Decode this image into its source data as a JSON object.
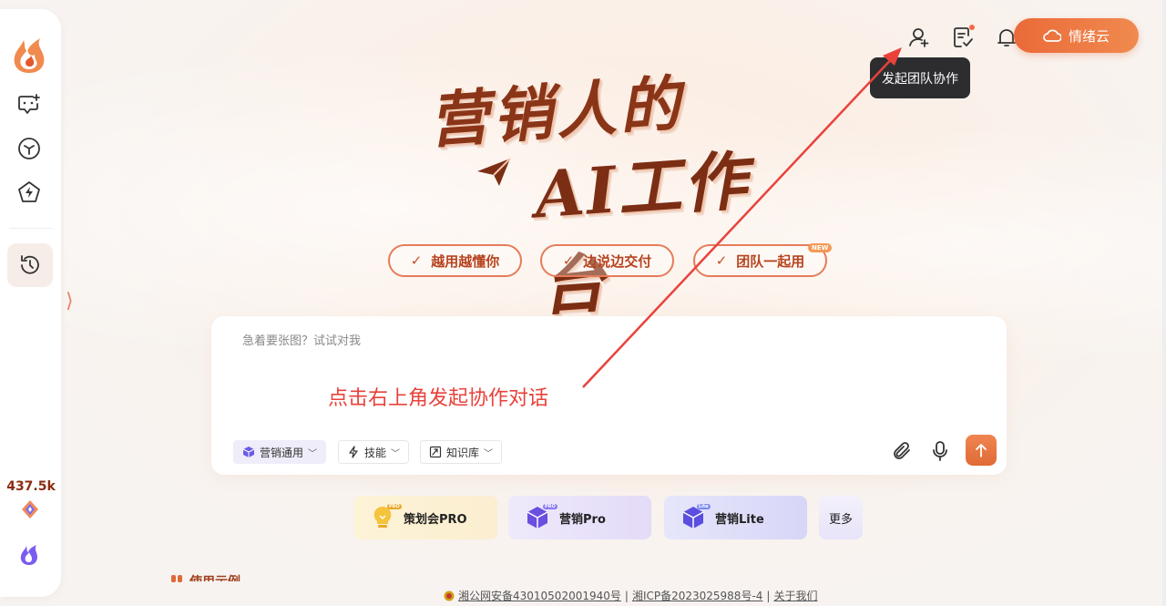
{
  "sidebar": {
    "stat_count": "437.5k"
  },
  "header": {
    "cloud_button_label": "情绪云",
    "tooltip_text": "发起团队协作"
  },
  "hero": {
    "line1": "营销人的",
    "line2": "AI工作台"
  },
  "tags": [
    {
      "label": "越用越懂你"
    },
    {
      "label": "边说边交付"
    },
    {
      "label": "团队一起用",
      "badge": "NEW"
    }
  ],
  "input": {
    "placeholder": "急着要张图？试试对我",
    "annotation": "点击右上角发起协作对话",
    "chips": [
      {
        "label": "营销通用"
      },
      {
        "label": "技能"
      },
      {
        "label": "知识库"
      }
    ]
  },
  "agents": [
    {
      "label": "策划会PRO",
      "badge": "PRO"
    },
    {
      "label": "营销Pro",
      "badge": "PRO"
    },
    {
      "label": "营销Lite",
      "badge": "Lite"
    }
  ],
  "more_label": "更多",
  "section": {
    "title": "使用示例"
  },
  "footer": {
    "police_record": "湘公网安备43010502001940号",
    "icp_record": "湘ICP备2023025988号-4",
    "about": "关于我们",
    "separator": "|"
  },
  "colors": {
    "accent": "#ea6a38",
    "title": "#8a3518",
    "annotation": "#e8423b",
    "tooltip_bg": "#2d2d30"
  }
}
